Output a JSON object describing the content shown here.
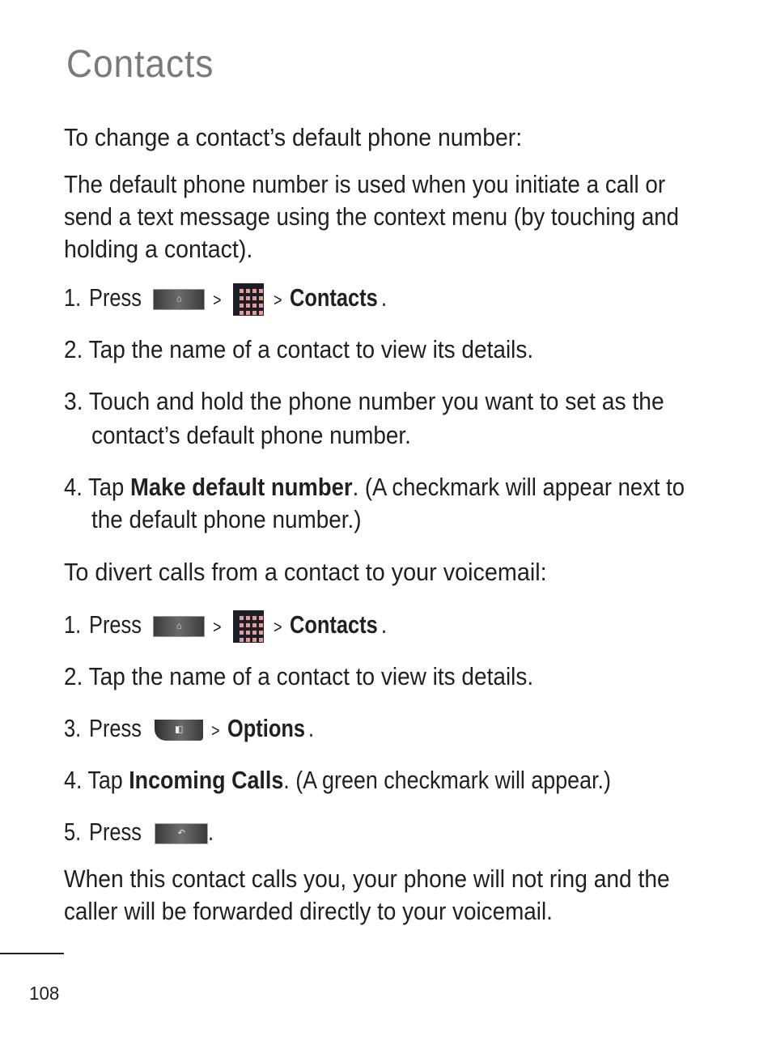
{
  "page": {
    "title": "Contacts",
    "page_number": "108"
  },
  "section1": {
    "heading": "To change a contact’s default phone number:",
    "intro_lines": [
      "The default phone number is used when you initiate a call or",
      "send a text message using the context menu (by touching and",
      "holding a contact)."
    ],
    "steps": {
      "s1": {
        "num": "1.",
        "pre": "Press",
        "sep1": ">",
        "sep2": ">",
        "target": "Contacts",
        "post": "."
      },
      "s2": {
        "num": "2.",
        "text": "Tap the name of a contact to view its details."
      },
      "s3": {
        "num": "3.",
        "line1": "Touch and hold the phone number you want to set as the",
        "line2": "contact’s default phone number."
      },
      "s4": {
        "num": "4.",
        "pre": "Tap",
        "target": "Make default number",
        "post": ". (A checkmark will appear next to",
        "line2": "the default phone number.)"
      }
    }
  },
  "section2": {
    "heading": "To divert calls from a contact to your voicemail:",
    "steps": {
      "s1": {
        "num": "1.",
        "pre": "Press",
        "sep1": ">",
        "sep2": ">",
        "target": "Contacts",
        "post": "."
      },
      "s2": {
        "num": "2.",
        "text": "Tap the name of a contact to view its details."
      },
      "s3": {
        "num": "3.",
        "pre": "Press",
        "sep": ">",
        "target": "Options",
        "post": "."
      },
      "s4": {
        "num": "4.",
        "pre": "Tap",
        "target": "Incoming Calls",
        "post": ". (A green checkmark will appear.)"
      },
      "s5": {
        "num": "5.",
        "pre": "Press",
        "post": "."
      }
    },
    "outro_lines": [
      "When this contact calls you, your phone will not ring and the",
      "caller will be forwarded directly to your voicemail."
    ]
  },
  "icons": {
    "home_key": "home-key",
    "apps_key": "applications-key",
    "menu_key": "menu-key",
    "back_key": "back-key"
  }
}
